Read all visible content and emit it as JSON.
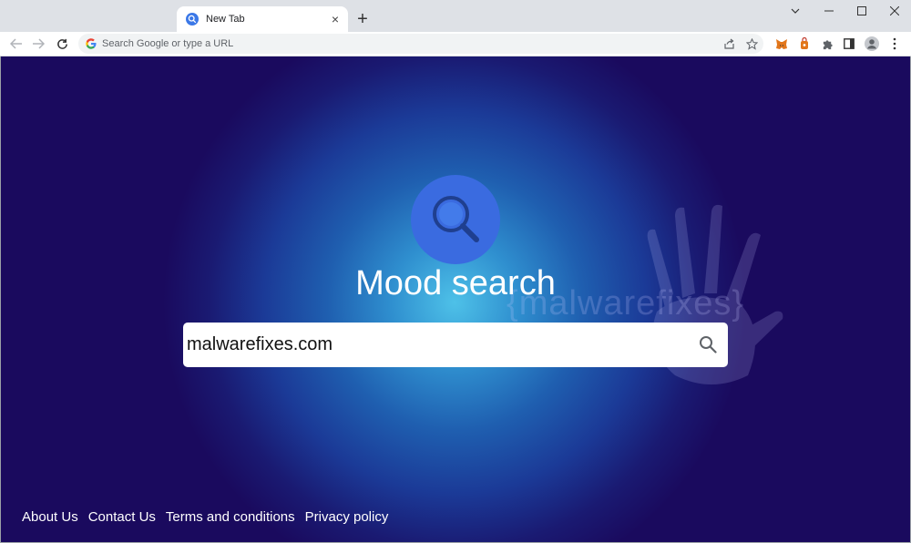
{
  "browser": {
    "tab": {
      "title": "New Tab",
      "close_label": "×"
    },
    "new_tab_label": "+",
    "omnibox": {
      "placeholder": "Search Google or type a URL",
      "value": ""
    }
  },
  "page": {
    "brand_title": "Mood search",
    "search": {
      "value": "malwarefixes.com"
    },
    "watermark": "{malwarefixes}",
    "footer_links": [
      {
        "label": "About Us"
      },
      {
        "label": "Contact Us"
      },
      {
        "label": "Terms and conditions"
      },
      {
        "label": "Privacy policy"
      }
    ]
  },
  "colors": {
    "page_bg": "#1a0a5e",
    "glow": "#4ec1e8",
    "logo": "#3a6be0",
    "tabstrip": "#dee1e6"
  }
}
